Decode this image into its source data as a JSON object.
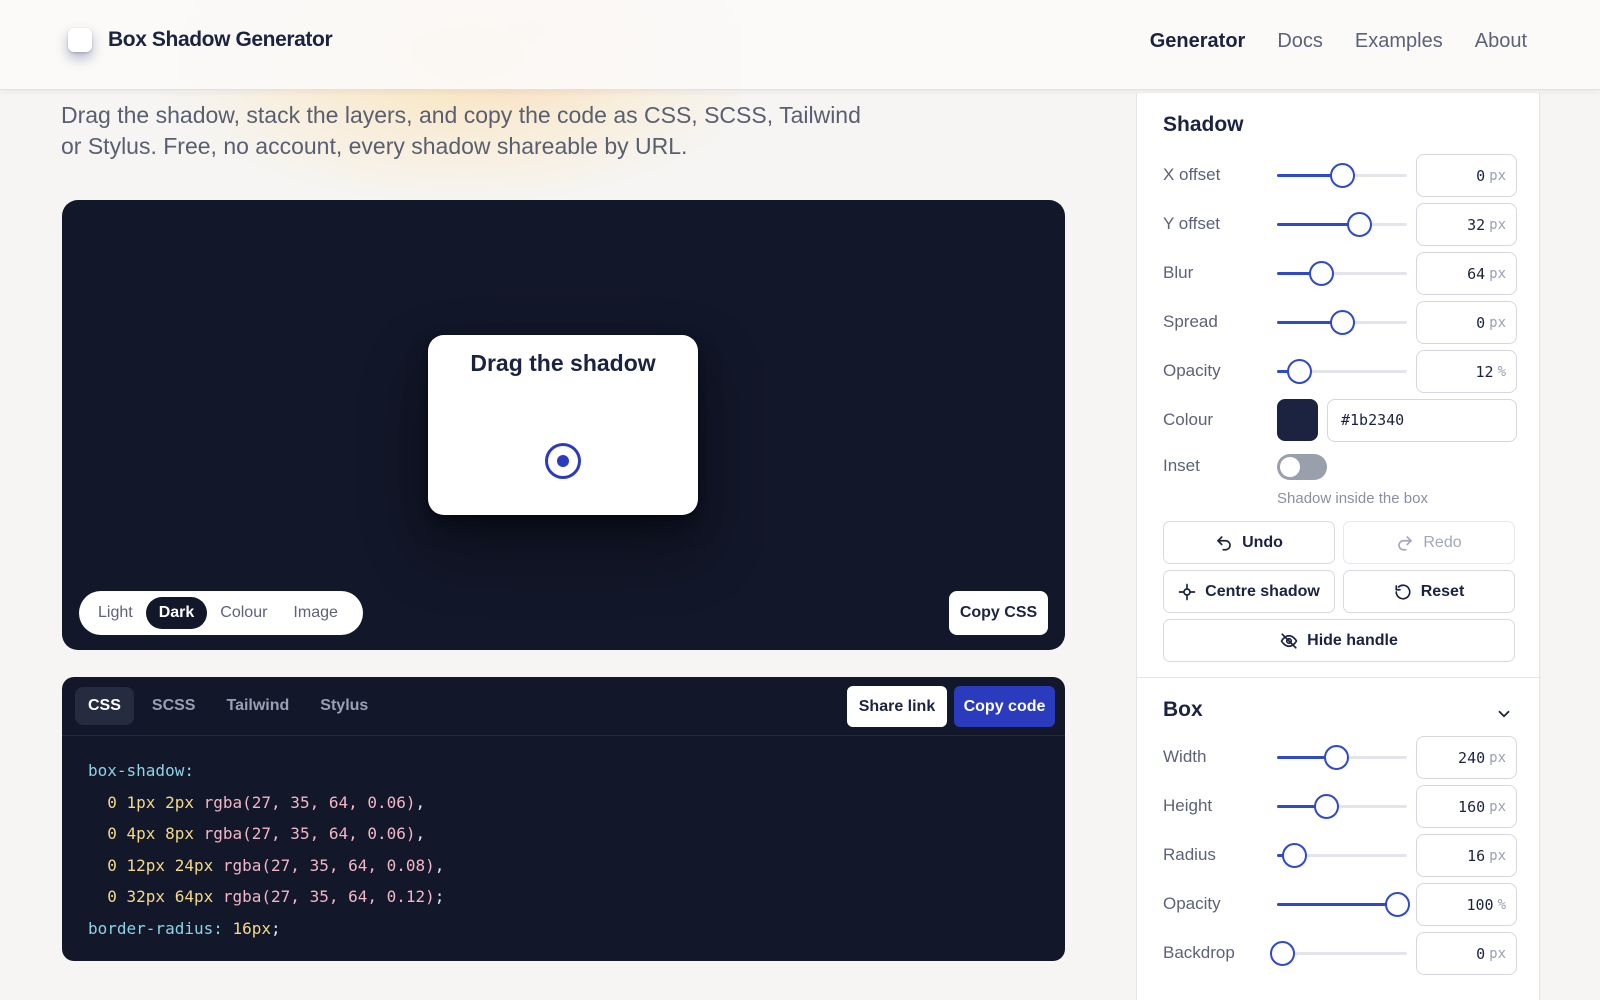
{
  "header": {
    "brand": "Box Shadow Generator",
    "nav": [
      {
        "label": "Generator",
        "active": true
      },
      {
        "label": "Docs",
        "active": false
      },
      {
        "label": "Examples",
        "active": false
      },
      {
        "label": "About",
        "active": false
      }
    ]
  },
  "intro": {
    "line1": "Drag the shadow, stack the layers, and copy the code as CSS, SCSS, Tailwind",
    "line2": "or Stylus. Free, no account, every shadow shareable by URL."
  },
  "stage": {
    "preview_title": "Drag the shadow",
    "backgrounds": [
      "Light",
      "Dark",
      "Colour",
      "Image"
    ],
    "active_background": "Dark",
    "copy_css": "Copy CSS"
  },
  "code_panel": {
    "tabs": [
      "CSS",
      "SCSS",
      "Tailwind",
      "Stylus"
    ],
    "active_tab": "CSS",
    "share_link": "Share link",
    "copy_code": "Copy code",
    "lines": {
      "prop": "box-shadow:",
      "l1": {
        "off": "0 1px 2px",
        "fn": "rgba(27, 35, 64, 0.06)",
        "end": ","
      },
      "l2": {
        "off": "0 4px 8px",
        "fn": "rgba(27, 35, 64, 0.06)",
        "end": ","
      },
      "l3": {
        "off": "0 12px 24px",
        "fn": "rgba(27, 35, 64, 0.08)",
        "end": ","
      },
      "l4": {
        "off": "0 32px 64px",
        "fn": "rgba(27, 35, 64, 0.12)",
        "end": ";"
      },
      "radius_prop": "border-radius:",
      "radius_val": "16px",
      "radius_end": ";"
    }
  },
  "shadow_panel": {
    "title": "Shadow",
    "x_offset": {
      "label": "X offset",
      "value": "0",
      "unit": "px",
      "level": 0.5
    },
    "y_offset": {
      "label": "Y offset",
      "value": "32",
      "unit": "px",
      "level": 0.63
    },
    "blur": {
      "label": "Blur",
      "value": "64",
      "unit": "px",
      "level": 0.34
    },
    "spread": {
      "label": "Spread",
      "value": "0",
      "unit": "px",
      "level": 0.5
    },
    "opacity": {
      "label": "Opacity",
      "value": "12",
      "unit": "%",
      "level": 0.17
    },
    "colour": {
      "label": "Colour",
      "value": "#1b2340"
    },
    "inset": {
      "label": "Inset",
      "on": false,
      "hint": "Shadow inside the box"
    },
    "undo": "Undo",
    "redo": "Redo",
    "centre": "Centre shadow",
    "reset": "Reset",
    "hide_handle": "Hide handle"
  },
  "box_panel": {
    "title": "Box",
    "width": {
      "label": "Width",
      "value": "240",
      "unit": "px",
      "level": 0.45
    },
    "height": {
      "label": "Height",
      "value": "160",
      "unit": "px",
      "level": 0.38
    },
    "radius": {
      "label": "Radius",
      "value": "16",
      "unit": "px",
      "level": 0.13
    },
    "opacity": {
      "label": "Opacity",
      "value": "100",
      "unit": "%",
      "level": 0.92
    },
    "backdrop": {
      "label": "Backdrop",
      "value": "0",
      "unit": "px",
      "level": 0.04
    }
  },
  "colors": {
    "accent": "#2f49c9",
    "stage_bg": "#121729",
    "shadow_colour": "#1b2340"
  }
}
